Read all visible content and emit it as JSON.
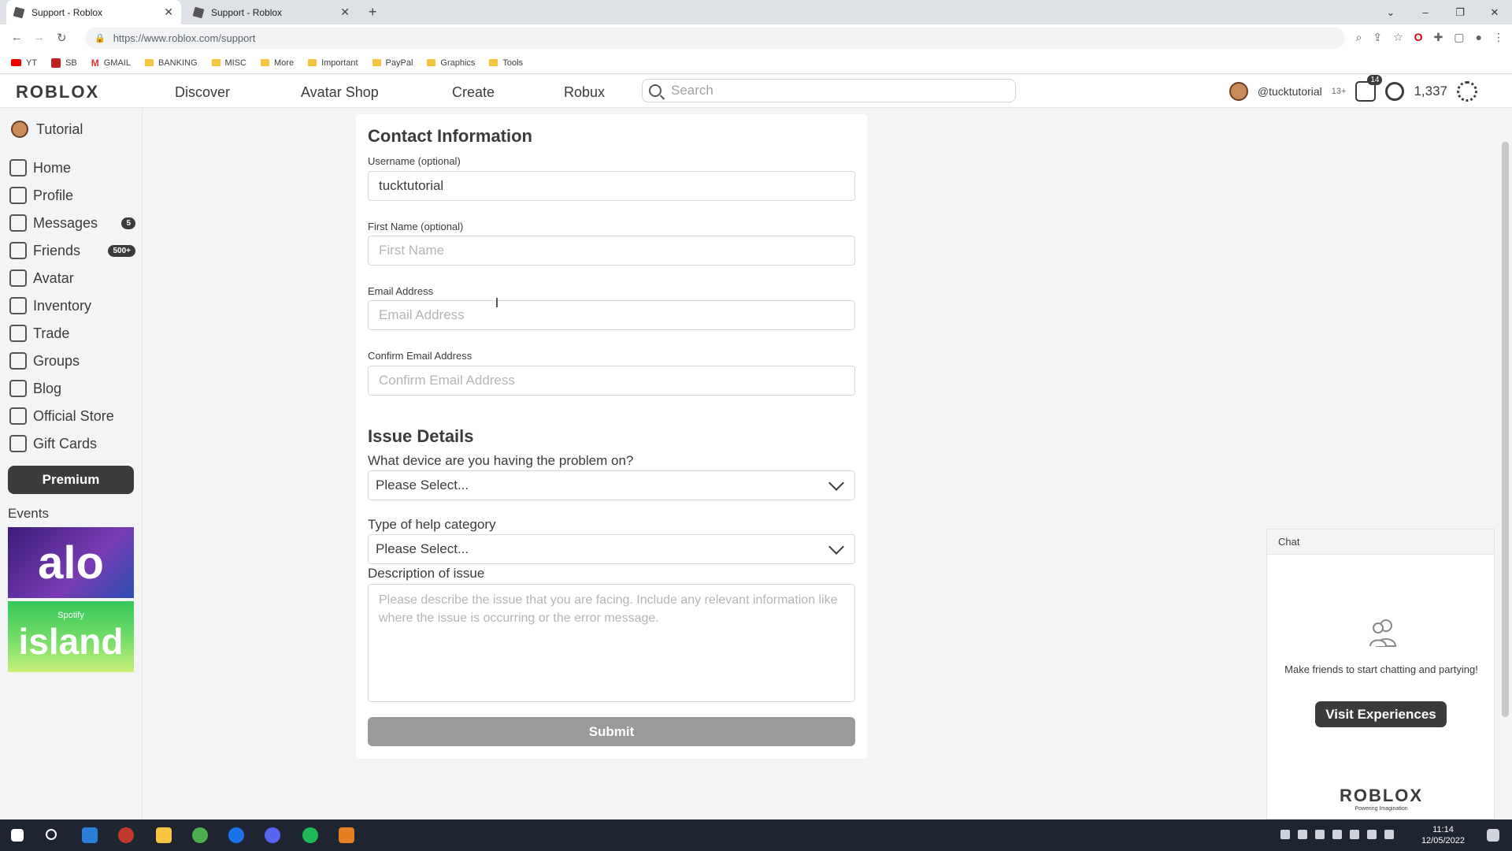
{
  "browser": {
    "tabs": [
      {
        "title": "Support - Roblox"
      },
      {
        "title": "Support - Roblox"
      }
    ],
    "url": "https://www.roblox.com/support",
    "bookmarks": [
      "YT",
      "SB",
      "GMAIL",
      "BANKING",
      "MISC",
      "More",
      "Important",
      "PayPal",
      "Graphics",
      "Tools"
    ]
  },
  "header": {
    "logo": "ROBLOX",
    "nav": [
      "Discover",
      "Avatar Shop",
      "Create",
      "Robux"
    ],
    "search_placeholder": "Search",
    "username": "@tucktutorial",
    "age": "13+",
    "notifications": "14",
    "robux": "1,337"
  },
  "sidebar": {
    "user": "Tutorial",
    "items": [
      {
        "label": "Home",
        "badge": ""
      },
      {
        "label": "Profile",
        "badge": ""
      },
      {
        "label": "Messages",
        "badge": "5"
      },
      {
        "label": "Friends",
        "badge": "500+"
      },
      {
        "label": "Avatar",
        "badge": ""
      },
      {
        "label": "Inventory",
        "badge": ""
      },
      {
        "label": "Trade",
        "badge": ""
      },
      {
        "label": "Groups",
        "badge": ""
      },
      {
        "label": "Blog",
        "badge": ""
      },
      {
        "label": "Official Store",
        "badge": ""
      },
      {
        "label": "Gift Cards",
        "badge": ""
      }
    ],
    "premium": "Premium",
    "events_label": "Events",
    "event1": "alo",
    "event2": "island",
    "event2_small": "Spotify"
  },
  "form": {
    "contact_heading": "Contact Information",
    "username_label": "Username (optional)",
    "username_value": "tucktutorial",
    "first_name_label": "First Name (optional)",
    "first_name_placeholder": "First Name",
    "email_label": "Email Address",
    "email_placeholder": "Email Address",
    "confirm_email_label": "Confirm Email Address",
    "confirm_email_placeholder": "Confirm Email Address",
    "issue_heading": "Issue Details",
    "device_label": "What device are you having the problem on?",
    "device_value": "Please Select...",
    "category_label": "Type of help category",
    "category_value": "Please Select...",
    "description_label": "Description of issue",
    "description_placeholder": "Please describe the issue that you are facing. Include any relevant information like where the issue is occurring or the error message.",
    "submit": "Submit"
  },
  "chat": {
    "title": "Chat",
    "message": "Make friends to start chatting and partying!",
    "button": "Visit Experiences",
    "logo": "ROBLOX",
    "tagline": "Powering Imagination"
  },
  "taskbar": {
    "time": "11:14",
    "date": "12/05/2022"
  }
}
